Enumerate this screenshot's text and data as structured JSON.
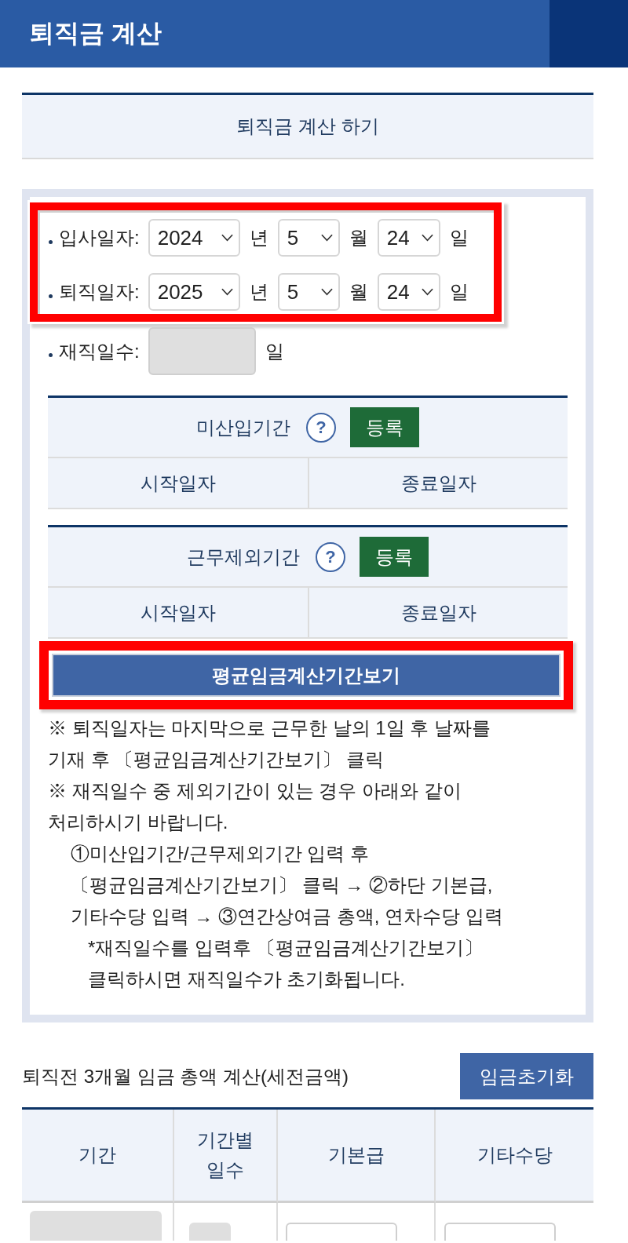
{
  "header": {
    "title": "퇴직금 계산"
  },
  "section_title": "퇴직금 계산 하기",
  "dates": {
    "highlighted": true,
    "rows": [
      {
        "label": "입사일자:",
        "year": "2024",
        "year_unit": "년",
        "month": "5",
        "month_unit": "월",
        "day": "24",
        "day_unit": "일"
      },
      {
        "label": "퇴직일자:",
        "year": "2025",
        "year_unit": "년",
        "month": "5",
        "month_unit": "월",
        "day": "24",
        "day_unit": "일"
      }
    ]
  },
  "tenure": {
    "label": "재직일수:",
    "disabled": true,
    "unit": "일"
  },
  "period_tables": [
    {
      "title": "미산입기간",
      "help": "?",
      "register_button": "등록",
      "columns": [
        "시작일자",
        "종료일자"
      ]
    },
    {
      "title": "근무제외기간",
      "help": "?",
      "register_button": "등록",
      "columns": [
        "시작일자",
        "종료일자"
      ]
    }
  ],
  "calc_button": {
    "label": "평균임금계산기간보기",
    "highlighted": true
  },
  "notes": [
    {
      "kind": "note",
      "lines": [
        "※ 퇴직일자는 마지막으로 근무한 날의 1일 후 날짜를",
        "기재 후 〔평균임금계산기간보기〕 클릭"
      ]
    },
    {
      "kind": "note",
      "lines": [
        "※ 재직일수 중 제외기간이 있는 경우 아래와 같이",
        "처리하시기 바랍니다."
      ]
    },
    {
      "kind": "step",
      "lines": [
        "①미산입기간/근무제외기간 입력 후",
        "〔평균임금계산기간보기〕 클릭 → ②하단 기본급,",
        "기타수당 입력 → ③연간상여금 총액, 연차수당 입력"
      ]
    },
    {
      "kind": "sub",
      "lines": [
        "*재직일수를 입력후 〔평균임금계산기간보기〕",
        "클릭하시면 재직일수가 초기화됩니다."
      ]
    }
  ],
  "wage_section": {
    "title": "퇴직전 3개월 임금 총액 계산(세전금액)",
    "reset_button": "임금초기화",
    "columns": [
      "기간",
      "기간별 일수",
      "기본급",
      "기타수당"
    ],
    "rows": [
      {
        "cells": [
          {
            "disabled": true
          },
          {
            "disabled": true
          },
          {
            "disabled": false
          },
          {
            "disabled": false
          }
        ]
      }
    ]
  }
}
